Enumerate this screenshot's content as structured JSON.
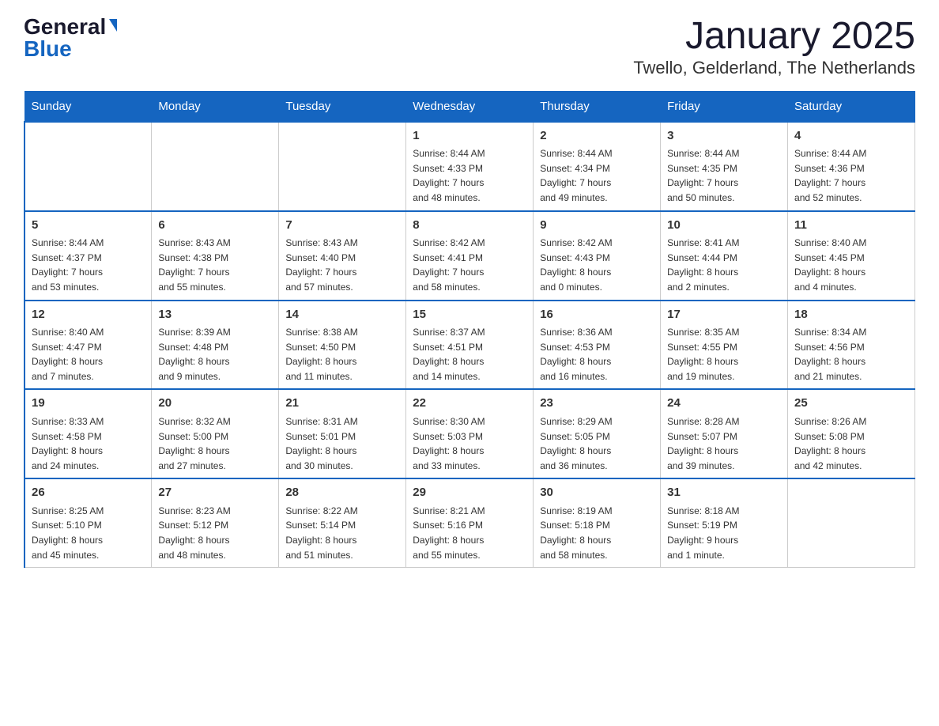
{
  "header": {
    "logo_general": "General",
    "logo_blue": "Blue",
    "month_title": "January 2025",
    "location": "Twello, Gelderland, The Netherlands"
  },
  "weekdays": [
    "Sunday",
    "Monday",
    "Tuesday",
    "Wednesday",
    "Thursday",
    "Friday",
    "Saturday"
  ],
  "weeks": [
    [
      {
        "day": "",
        "info": ""
      },
      {
        "day": "",
        "info": ""
      },
      {
        "day": "",
        "info": ""
      },
      {
        "day": "1",
        "info": "Sunrise: 8:44 AM\nSunset: 4:33 PM\nDaylight: 7 hours\nand 48 minutes."
      },
      {
        "day": "2",
        "info": "Sunrise: 8:44 AM\nSunset: 4:34 PM\nDaylight: 7 hours\nand 49 minutes."
      },
      {
        "day": "3",
        "info": "Sunrise: 8:44 AM\nSunset: 4:35 PM\nDaylight: 7 hours\nand 50 minutes."
      },
      {
        "day": "4",
        "info": "Sunrise: 8:44 AM\nSunset: 4:36 PM\nDaylight: 7 hours\nand 52 minutes."
      }
    ],
    [
      {
        "day": "5",
        "info": "Sunrise: 8:44 AM\nSunset: 4:37 PM\nDaylight: 7 hours\nand 53 minutes."
      },
      {
        "day": "6",
        "info": "Sunrise: 8:43 AM\nSunset: 4:38 PM\nDaylight: 7 hours\nand 55 minutes."
      },
      {
        "day": "7",
        "info": "Sunrise: 8:43 AM\nSunset: 4:40 PM\nDaylight: 7 hours\nand 57 minutes."
      },
      {
        "day": "8",
        "info": "Sunrise: 8:42 AM\nSunset: 4:41 PM\nDaylight: 7 hours\nand 58 minutes."
      },
      {
        "day": "9",
        "info": "Sunrise: 8:42 AM\nSunset: 4:43 PM\nDaylight: 8 hours\nand 0 minutes."
      },
      {
        "day": "10",
        "info": "Sunrise: 8:41 AM\nSunset: 4:44 PM\nDaylight: 8 hours\nand 2 minutes."
      },
      {
        "day": "11",
        "info": "Sunrise: 8:40 AM\nSunset: 4:45 PM\nDaylight: 8 hours\nand 4 minutes."
      }
    ],
    [
      {
        "day": "12",
        "info": "Sunrise: 8:40 AM\nSunset: 4:47 PM\nDaylight: 8 hours\nand 7 minutes."
      },
      {
        "day": "13",
        "info": "Sunrise: 8:39 AM\nSunset: 4:48 PM\nDaylight: 8 hours\nand 9 minutes."
      },
      {
        "day": "14",
        "info": "Sunrise: 8:38 AM\nSunset: 4:50 PM\nDaylight: 8 hours\nand 11 minutes."
      },
      {
        "day": "15",
        "info": "Sunrise: 8:37 AM\nSunset: 4:51 PM\nDaylight: 8 hours\nand 14 minutes."
      },
      {
        "day": "16",
        "info": "Sunrise: 8:36 AM\nSunset: 4:53 PM\nDaylight: 8 hours\nand 16 minutes."
      },
      {
        "day": "17",
        "info": "Sunrise: 8:35 AM\nSunset: 4:55 PM\nDaylight: 8 hours\nand 19 minutes."
      },
      {
        "day": "18",
        "info": "Sunrise: 8:34 AM\nSunset: 4:56 PM\nDaylight: 8 hours\nand 21 minutes."
      }
    ],
    [
      {
        "day": "19",
        "info": "Sunrise: 8:33 AM\nSunset: 4:58 PM\nDaylight: 8 hours\nand 24 minutes."
      },
      {
        "day": "20",
        "info": "Sunrise: 8:32 AM\nSunset: 5:00 PM\nDaylight: 8 hours\nand 27 minutes."
      },
      {
        "day": "21",
        "info": "Sunrise: 8:31 AM\nSunset: 5:01 PM\nDaylight: 8 hours\nand 30 minutes."
      },
      {
        "day": "22",
        "info": "Sunrise: 8:30 AM\nSunset: 5:03 PM\nDaylight: 8 hours\nand 33 minutes."
      },
      {
        "day": "23",
        "info": "Sunrise: 8:29 AM\nSunset: 5:05 PM\nDaylight: 8 hours\nand 36 minutes."
      },
      {
        "day": "24",
        "info": "Sunrise: 8:28 AM\nSunset: 5:07 PM\nDaylight: 8 hours\nand 39 minutes."
      },
      {
        "day": "25",
        "info": "Sunrise: 8:26 AM\nSunset: 5:08 PM\nDaylight: 8 hours\nand 42 minutes."
      }
    ],
    [
      {
        "day": "26",
        "info": "Sunrise: 8:25 AM\nSunset: 5:10 PM\nDaylight: 8 hours\nand 45 minutes."
      },
      {
        "day": "27",
        "info": "Sunrise: 8:23 AM\nSunset: 5:12 PM\nDaylight: 8 hours\nand 48 minutes."
      },
      {
        "day": "28",
        "info": "Sunrise: 8:22 AM\nSunset: 5:14 PM\nDaylight: 8 hours\nand 51 minutes."
      },
      {
        "day": "29",
        "info": "Sunrise: 8:21 AM\nSunset: 5:16 PM\nDaylight: 8 hours\nand 55 minutes."
      },
      {
        "day": "30",
        "info": "Sunrise: 8:19 AM\nSunset: 5:18 PM\nDaylight: 8 hours\nand 58 minutes."
      },
      {
        "day": "31",
        "info": "Sunrise: 8:18 AM\nSunset: 5:19 PM\nDaylight: 9 hours\nand 1 minute."
      },
      {
        "day": "",
        "info": ""
      }
    ]
  ]
}
